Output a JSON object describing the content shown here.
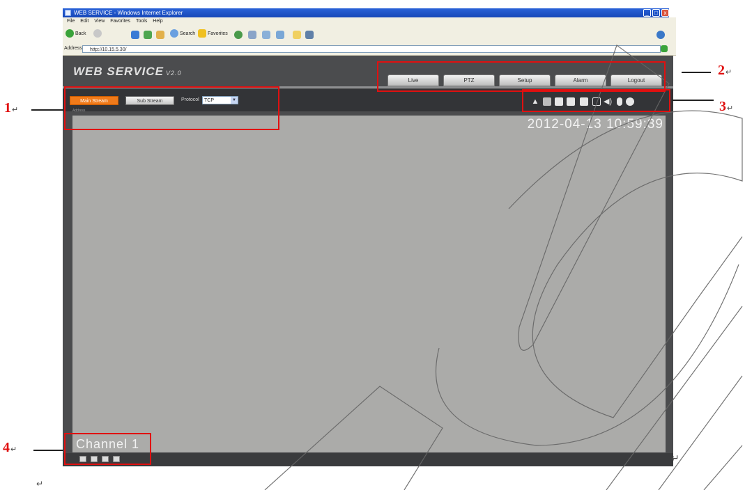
{
  "browser": {
    "title": "WEB SERVICE - Windows Internet Explorer",
    "menu": [
      "File",
      "Edit",
      "View",
      "Favorites",
      "Tools",
      "Help"
    ],
    "toolbar": {
      "back_label": "Back",
      "search_label": "Search",
      "favorites_label": "Favorites"
    },
    "address_label": "Address",
    "address_value": "http://10.15.5.30/",
    "go_label": "Go"
  },
  "app": {
    "logo": "WEB  SERVICE",
    "logo_version": "V2.0",
    "nav_tabs": [
      "Live",
      "PTZ",
      "Setup",
      "Alarm",
      "Logout"
    ],
    "main_stream_label": "Main Stream",
    "sub_stream_label": "Sub Stream",
    "protocol_label": "Protocol",
    "protocol_value": "TCP",
    "address_hint": "Address",
    "datetime": "2012-04-13 10:59:39",
    "channel_label": "Channel 1"
  },
  "annotations": {
    "label_1": "1",
    "label_2": "2",
    "label_3": "3",
    "label_4": "4",
    "return_mark": "↵"
  },
  "colors": {
    "accent_orange": "#f07a1a",
    "annotation_red": "#e01010",
    "video_bg": "#ababa9",
    "app_bg": "#4b4c4e"
  }
}
